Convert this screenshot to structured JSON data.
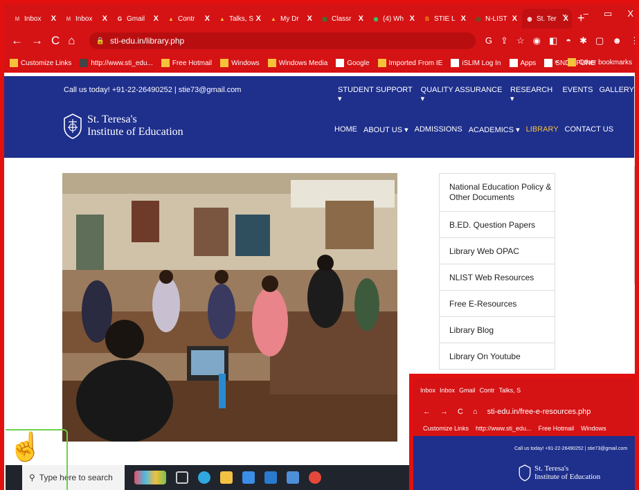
{
  "browser": {
    "tabs": [
      {
        "label": "Inbox",
        "icon": "gmail-icon",
        "color": "#f2a0a0",
        "glyph": "M",
        "close": "X"
      },
      {
        "label": "Inbox",
        "icon": "gmail-icon",
        "color": "#f2a0a0",
        "glyph": "M",
        "close": "X"
      },
      {
        "label": "Gmail",
        "icon": "google-icon",
        "color": "#ffffff",
        "glyph": "G",
        "close": "X"
      },
      {
        "label": "Contr",
        "icon": "drive-icon",
        "color": "#f5c23a",
        "glyph": "▲",
        "close": "X"
      },
      {
        "label": "Talks, S",
        "icon": "drive-icon",
        "color": "#f5c23a",
        "glyph": "▲",
        "close": "X"
      },
      {
        "label": "My Dr",
        "icon": "drive-icon",
        "color": "#f5c23a",
        "glyph": "▲",
        "close": "X"
      },
      {
        "label": "Classr",
        "icon": "classroom-icon",
        "color": "#2e7d32",
        "glyph": "▣",
        "close": "X"
      },
      {
        "label": "(4) Wh",
        "icon": "whatsapp-icon",
        "color": "#25d366",
        "glyph": "◉",
        "close": "X"
      },
      {
        "label": "STIE L",
        "icon": "bookmark-orange-icon",
        "color": "#f39c12",
        "glyph": "B",
        "close": "X"
      },
      {
        "label": "N-LIST",
        "icon": "nlist-icon",
        "color": "#1a7f37",
        "glyph": "◎",
        "close": "X"
      },
      {
        "label": "St. Ter",
        "icon": "globe-icon",
        "color": "#ffffff",
        "glyph": "◍",
        "close": "X"
      }
    ],
    "new_tab": "+",
    "window_controls": {
      "dropdown": "⌄",
      "minimize": "–",
      "maximize": "▭",
      "close": "X"
    },
    "nav": {
      "back": "←",
      "forward": "→",
      "reload": "C",
      "home": "⌂"
    },
    "url": "sti-edu.in/library.php",
    "extension_icons": [
      "G",
      "⇪",
      "☆",
      "◉",
      "◧",
      "◓",
      "✱",
      "▢",
      "☻",
      "⋮"
    ],
    "bookmarks": [
      {
        "label": "Customize Links",
        "color": "#f5c23a"
      },
      {
        "label": "http://www.sti_edu...",
        "color": "#444444"
      },
      {
        "label": "Free Hotmail",
        "color": "#f5c23a"
      },
      {
        "label": "Windows",
        "color": "#f5c23a"
      },
      {
        "label": "Windows Media",
        "color": "#f5c23a"
      },
      {
        "label": "Google",
        "color": "#ffffff"
      },
      {
        "label": "Imported From IE",
        "color": "#f5c23a"
      },
      {
        "label": "iSLIM Log In",
        "color": "#ffffff"
      },
      {
        "label": "Apps",
        "color": "#ffffff"
      },
      {
        "label": "SNDT PUNE",
        "color": "#ffffff"
      }
    ],
    "bookmarks_more": "»",
    "other_bookmarks": "Other bookmarks"
  },
  "site": {
    "call_text": "Call us today! +91-22-26490252 | stie73@gmail.com",
    "top_nav": [
      "STUDENT SUPPORT ▾",
      "QUALITY ASSURANCE ▾",
      "RESEARCH ▾",
      "EVENTS",
      "GALLERY"
    ],
    "logo_line1": "St. Teresa's",
    "logo_line2": "Institute of Education",
    "main_nav": [
      "HOME",
      "ABOUT US ▾",
      "ADMISSIONS",
      "ACADEMICS ▾",
      "LIBRARY",
      "CONTACT US"
    ],
    "side_menu": [
      "National Education Policy & Other Documents",
      "B.ED. Question Papers",
      "Library Web OPAC",
      "NLIST Web Resources",
      "Free E-Resources",
      "Library Blog",
      "Library On Youtube"
    ]
  },
  "taskbar": {
    "search_placeholder": "Type here to search"
  },
  "inset": {
    "tabs": [
      "Inbox",
      "Inbox",
      "Gmail",
      "Contr",
      "Talks, S"
    ],
    "url": "sti-edu.in/free-e-resources.php",
    "bookmarks": [
      "Customize Links",
      "http://www.sti_edu...",
      "Free Hotmail",
      "Windows"
    ],
    "call_text": "Call us today! +91-22-26490252 | stie73@gmail.com",
    "logo_line1": "St. Teresa's",
    "logo_line2": "Institute of Education"
  },
  "colors": {
    "browser_red": "#d51214",
    "site_blue": "#1e2f8c",
    "active_nav": "#f5c23a"
  }
}
